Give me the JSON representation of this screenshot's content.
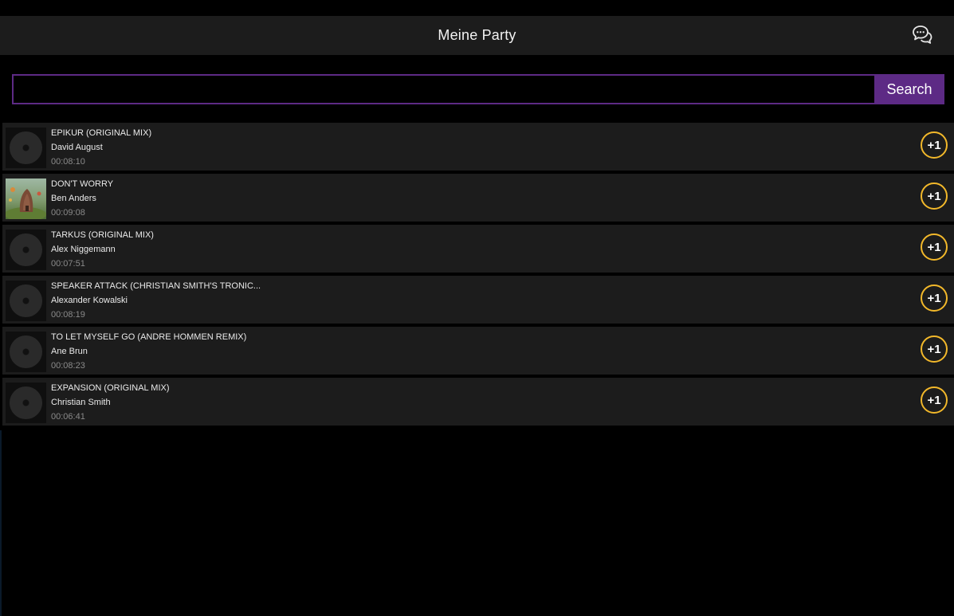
{
  "header": {
    "title": "Meine Party",
    "chat_icon": "chat-bubbles-icon"
  },
  "search": {
    "placeholder": "",
    "value": "",
    "button_label": "Search",
    "accent_color": "#5d2a85"
  },
  "vote_color": "#f2b82a",
  "tracks": [
    {
      "title": "EPIKUR (ORIGINAL MIX)",
      "artist": "David August",
      "duration": "00:08:10",
      "cover": "vinyl-placeholder",
      "vote_label": "+1"
    },
    {
      "title": "DON'T WORRY",
      "artist": "Ben Anders",
      "duration": "00:09:08",
      "cover": "album-art",
      "vote_label": "+1"
    },
    {
      "title": "TARKUS (ORIGINAL MIX)",
      "artist": "Alex Niggemann",
      "duration": "00:07:51",
      "cover": "vinyl-placeholder",
      "vote_label": "+1"
    },
    {
      "title": "SPEAKER ATTACK (CHRISTIAN SMITH'S TRONIC...",
      "artist": "Alexander Kowalski",
      "duration": "00:08:19",
      "cover": "vinyl-placeholder",
      "vote_label": "+1"
    },
    {
      "title": "TO LET MYSELF GO (ANDRE HOMMEN REMIX)",
      "artist": "Ane Brun",
      "duration": "00:08:23",
      "cover": "vinyl-placeholder",
      "vote_label": "+1"
    },
    {
      "title": "EXPANSION (ORIGINAL MIX)",
      "artist": "Christian Smith",
      "duration": "00:06:41",
      "cover": "vinyl-placeholder",
      "vote_label": "+1"
    }
  ]
}
